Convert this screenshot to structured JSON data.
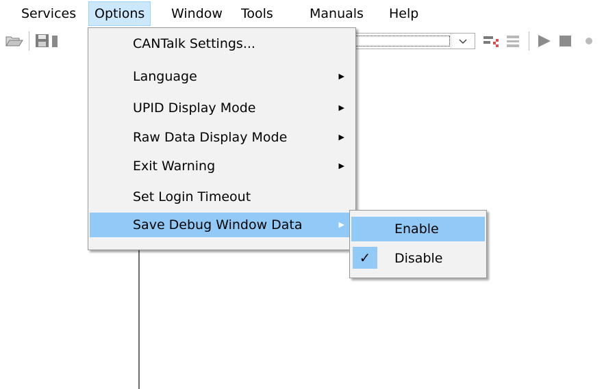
{
  "menubar": {
    "items": [
      {
        "label": "Services"
      },
      {
        "label": "Options"
      },
      {
        "label": "Window"
      },
      {
        "label": "Tools"
      },
      {
        "label": "Manuals"
      },
      {
        "label": "Help"
      }
    ],
    "active_color": "#cce8ff"
  },
  "options_menu": {
    "items": [
      {
        "label": "CANTalk Settings...",
        "has_submenu": false
      },
      {
        "label": "Language",
        "has_submenu": true
      },
      {
        "label": "UPID Display Mode",
        "has_submenu": true
      },
      {
        "label": "Raw Data Display Mode",
        "has_submenu": true
      },
      {
        "label": "Exit Warning",
        "has_submenu": true
      },
      {
        "label": "Set Login Timeout",
        "has_submenu": false
      },
      {
        "label": "Save Debug Window Data",
        "has_submenu": true,
        "highlighted": true
      }
    ]
  },
  "debug_submenu": {
    "items": [
      {
        "label": "Enable",
        "checked": false,
        "highlighted": true
      },
      {
        "label": "Disable",
        "checked": true
      }
    ],
    "check_glyph": "✓"
  },
  "toolbar": {
    "icons": [
      "open-folder-icon",
      "save-icon",
      "combo-dropdown",
      "connect-icon",
      "filter-icon",
      "play-icon",
      "stop-icon"
    ]
  },
  "colors": {
    "highlight": "#91c9f7",
    "menu_background": "#f2f2f2",
    "menu_border": "#979797"
  }
}
